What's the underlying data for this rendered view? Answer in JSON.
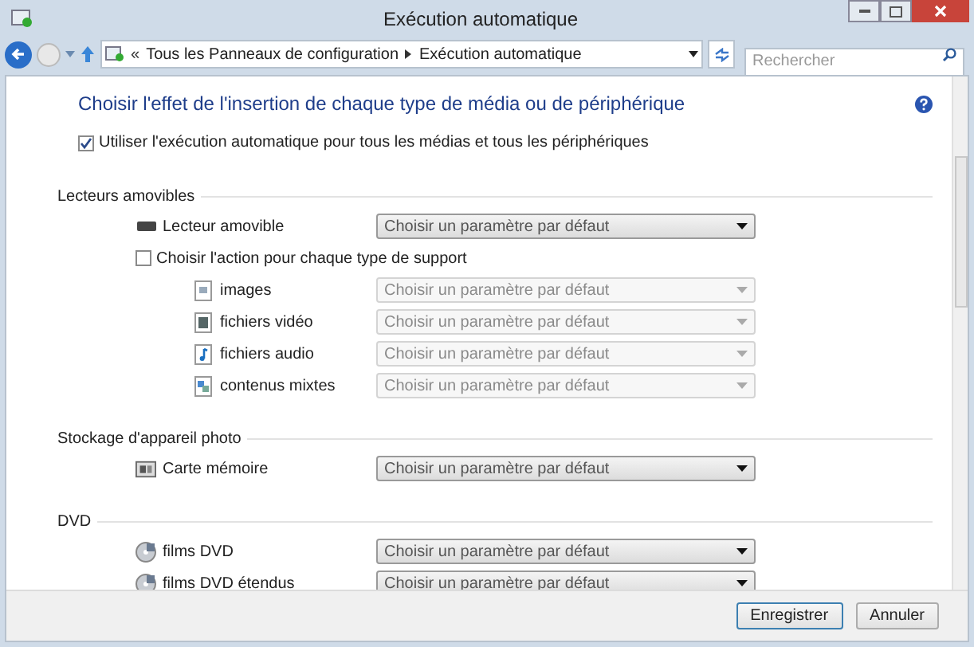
{
  "window": {
    "title": "Exécution automatique"
  },
  "address_bar": {
    "prefix": "«",
    "path": [
      "Tous les Panneaux de configuration",
      "Exécution automatique"
    ]
  },
  "search": {
    "placeholder": "Rechercher"
  },
  "heading": "Choisir l'effet de l'insertion de chaque type de média ou de périphérique",
  "master_checkbox": {
    "label": "Utiliser l'exécution automatique pour tous les médias et tous les périphériques",
    "checked": true
  },
  "sections": [
    {
      "title": "Lecteurs amovibles",
      "items": [
        {
          "kind": "drive",
          "label": "Lecteur amovible",
          "value": "Choisir un paramètre par défaut",
          "disabled": false
        },
        {
          "kind": "checkbox",
          "label": "Choisir l'action pour chaque type de support",
          "checked": false,
          "children": [
            {
              "kind": "images",
              "label": "images",
              "value": "Choisir un paramètre par défaut",
              "disabled": true
            },
            {
              "kind": "video",
              "label": "fichiers vidéo",
              "value": "Choisir un paramètre par défaut",
              "disabled": true
            },
            {
              "kind": "audio",
              "label": "fichiers audio",
              "value": "Choisir un paramètre par défaut",
              "disabled": true
            },
            {
              "kind": "mixed",
              "label": "contenus mixtes",
              "value": "Choisir un paramètre par défaut",
              "disabled": true
            }
          ]
        }
      ]
    },
    {
      "title": "Stockage d'appareil photo",
      "items": [
        {
          "kind": "card",
          "label": "Carte mémoire",
          "value": "Choisir un paramètre par défaut",
          "disabled": false
        }
      ]
    },
    {
      "title": "DVD",
      "items": [
        {
          "kind": "dvd",
          "label": "films DVD",
          "value": "Choisir un paramètre par défaut",
          "disabled": false
        },
        {
          "kind": "dvd",
          "label": "films DVD étendus",
          "value": "Choisir un paramètre par défaut",
          "disabled": false
        }
      ]
    }
  ],
  "buttons": [
    {
      "label": "Enregistrer",
      "default": true
    },
    {
      "label": "Annuler",
      "default": false
    }
  ]
}
